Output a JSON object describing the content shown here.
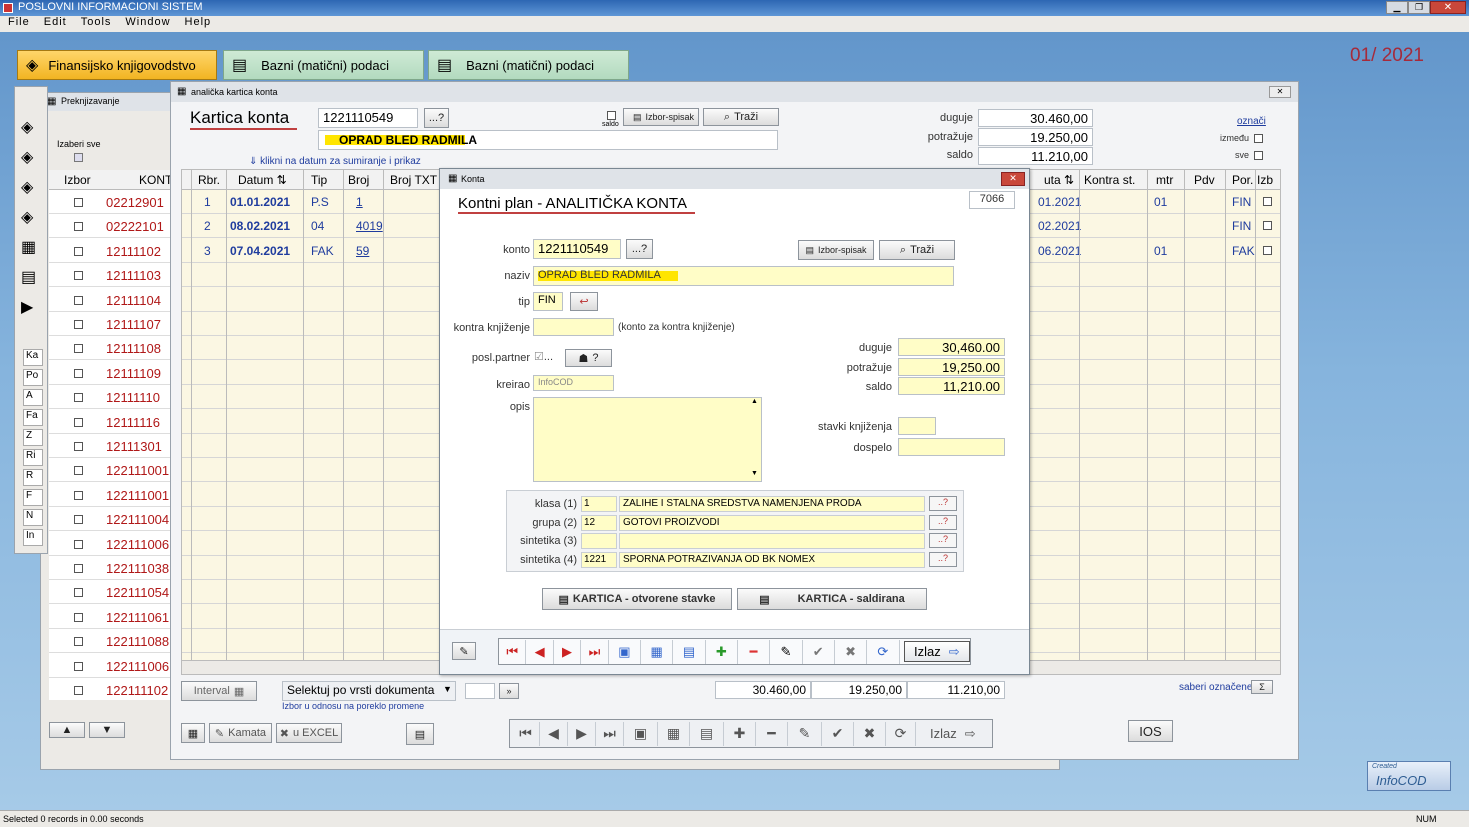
{
  "app": {
    "title": "POSLOVNI INFORMACIONI SISTEM",
    "period": "01/ 2021",
    "status": "Selected 0 records in 0.00 seconds",
    "num": "NUM",
    "menu": [
      "File",
      "Edit",
      "Tools",
      "Window",
      "Help"
    ]
  },
  "tabs": [
    {
      "label": "Finansijsko knjigovodstvo"
    },
    {
      "label": "Bazni (matični) podaci"
    },
    {
      "label": "Bazni (matični) podaci"
    }
  ],
  "prek": {
    "title": "Preknjizavanje",
    "izaberi": "Izaberi sve",
    "col_izbor": "Izbor",
    "col_konto": "KONT",
    "side_labels": [
      "Ka",
      "Po",
      "A",
      "Fa",
      "Z",
      "Ri",
      "R",
      "F",
      "N",
      "In"
    ],
    "kontos": [
      "02212901",
      "02222101",
      "12111102",
      "12111103",
      "12111104",
      "12111107",
      "12111108",
      "12111109",
      "12111110",
      "12111116",
      "12111301",
      "122111001",
      "122111001",
      "122111004",
      "122111006",
      "122111038",
      "122111054",
      "122111061",
      "122111088",
      "122111006",
      "122111102"
    ]
  },
  "kartica": {
    "win_title": "analička kartica konta",
    "title": "Kartica konta",
    "konto": "1221110549",
    "lookup": "...?",
    "partner": "OPRAD BLED RADMILA",
    "saldo_lbl": "saldo",
    "izbor_spisak": "Izbor-spisak",
    "trazi": "Traži",
    "duguje_lbl": "duguje",
    "potrazuje_lbl": "potražuje",
    "saldo2_lbl": "saldo",
    "duguje": "30.460,00",
    "potrazuje": "19.250,00",
    "saldo": "11.210,00",
    "oznaci": "označi",
    "izmedu": "između",
    "sve": "sve",
    "hint": "klikni na datum za sumiranje i prikaz",
    "cols_left": [
      "Rbr.",
      "Datum",
      "Tip",
      "Broj",
      "Broj TXT"
    ],
    "cols_right": [
      "uta",
      "Kontra st.",
      "mtr",
      "Pdv",
      "Por.",
      "Izb"
    ],
    "rows": [
      {
        "rbr": "1",
        "datum": "01.01.2021",
        "tip": "P.S",
        "broj": "1",
        "dat_r": "01.2021",
        "mtr": "01",
        "por": "FIN"
      },
      {
        "rbr": "2",
        "datum": "08.02.2021",
        "tip": "04",
        "broj": "4019",
        "dat_r": "02.2021",
        "mtr": "",
        "por": "FIN"
      },
      {
        "rbr": "3",
        "datum": "07.04.2021",
        "tip": "FAK",
        "broj": "59",
        "dat_r": "06.2021",
        "mtr": "01",
        "por": "FAK"
      }
    ],
    "interval": "Interval",
    "selektuj": "Selektuj po vrsti dokumenta",
    "izbor_note": "Izbor u odnosu na poreklo promene",
    "tot_d": "30.460,00",
    "tot_p": "19.250,00",
    "tot_s": "11.210,00",
    "saberi": "saberi označene",
    "kamata": "Kamata",
    "excel": "u EXCEL",
    "izlaz": "Izlaz",
    "ios": "IOS"
  },
  "konta": {
    "win_title": "Konta",
    "title": "Kontni plan - ANALITIČKA KONTA",
    "id": "7066",
    "konto_lbl": "konto",
    "konto": "1221110549",
    "lookup": "...?",
    "izbor_spisak": "Izbor-spisak",
    "trazi": "Traži",
    "naziv_lbl": "naziv",
    "naziv": "OPRAD BLED RADMILA",
    "tip_lbl": "tip",
    "tip": "FIN",
    "kontra_lbl": "kontra knjiženje",
    "kontra_note": "(konto za kontra knjiženje)",
    "posl_lbl": "posl.partner",
    "posl_dots": "...",
    "kreirao_lbl": "kreirao",
    "kreirao": "InfoCOD",
    "opis_lbl": "opis",
    "duguje_lbl": "duguje",
    "potrazuje_lbl": "potražuje",
    "saldo_lbl": "saldo",
    "duguje": "30,460.00",
    "potrazuje": "19,250.00",
    "saldo": "11,210.00",
    "stavki_lbl": "stavki knjiženja",
    "dospelo_lbl": "dospelo",
    "klase": [
      {
        "lbl": "klasa (1)",
        "code": "1",
        "name": "ZALIHE I STALNA SREDSTVA NAMENJENA PRODA"
      },
      {
        "lbl": "grupa (2)",
        "code": "12",
        "name": "GOTOVI PROIZVODI"
      },
      {
        "lbl": "sintetika (3)",
        "code": "",
        "name": ""
      },
      {
        "lbl": "sintetika (4)",
        "code": "1221",
        "name": "SPORNA POTRAZIVANJA OD BK NOMEX"
      }
    ],
    "lk": "..?",
    "kart_otv": "KARTICA - otvorene stavke",
    "kart_sal": "KARTICA - saldirana",
    "izlaz": "Izlaz"
  },
  "brand": {
    "created": "Created",
    "name": "InfoCOD"
  },
  "colors": {
    "accent": "#ffd84a",
    "link": "#1f3c9e",
    "konto_red": "#b01818"
  }
}
